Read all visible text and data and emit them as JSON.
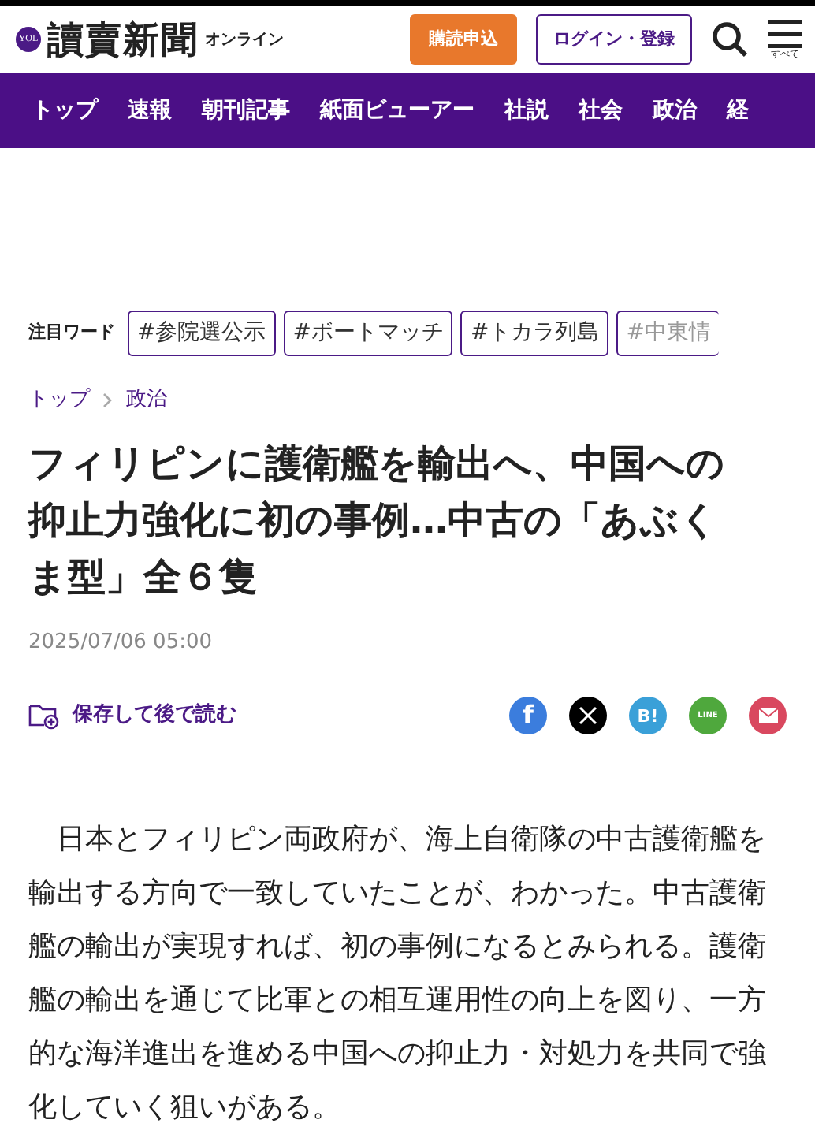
{
  "header": {
    "logo_mark": "YOL",
    "logo": "讀賣新聞",
    "logo_sub": "オンライン",
    "subscribe_button": "購読申込",
    "login_button": "ログイン・登録",
    "menu_label": "すべて"
  },
  "nav": [
    {
      "label": "トップ"
    },
    {
      "label": "速報"
    },
    {
      "label": "朝刊記事"
    },
    {
      "label": "紙面ビューアー"
    },
    {
      "label": "社説"
    },
    {
      "label": "社会"
    },
    {
      "label": "政治"
    },
    {
      "label": "経"
    }
  ],
  "trending": {
    "label": "注目ワード",
    "tags": [
      "#参院選公示",
      "#ボートマッチ",
      "#トカラ列島",
      "#中東情"
    ]
  },
  "breadcrumb": [
    "トップ",
    "政治"
  ],
  "article": {
    "title": "フィリピンに護衛艦を輸出へ、中国への抑止力強化に初の事例…中古の「あぶくま型」全６隻",
    "date": "2025/07/06 05:00",
    "save_label": "保存して後で読む",
    "share": [
      {
        "kind": "facebook",
        "label": "f",
        "color": "#3b7ddd"
      },
      {
        "kind": "x",
        "color": "#000000"
      },
      {
        "kind": "hatena",
        "label": "B!",
        "color": "#3aa0d8"
      },
      {
        "kind": "line",
        "label": "LINE",
        "color": "#4fa83d"
      },
      {
        "kind": "mail",
        "color": "#d9485f"
      }
    ],
    "body": "日本とフィリピン両政府が、海上自衛隊の中古護衛艦を輸出する方向で一致していたことが、わかった。中古護衛艦の輸出が実現すれば、初の事例になるとみられる。護衛艦の輸出を通じて比軍との相互運用性の向上を図り、一方的な海洋進出を進める中国への抑止力・対処力を共同で強化していく狙いがある。"
  }
}
